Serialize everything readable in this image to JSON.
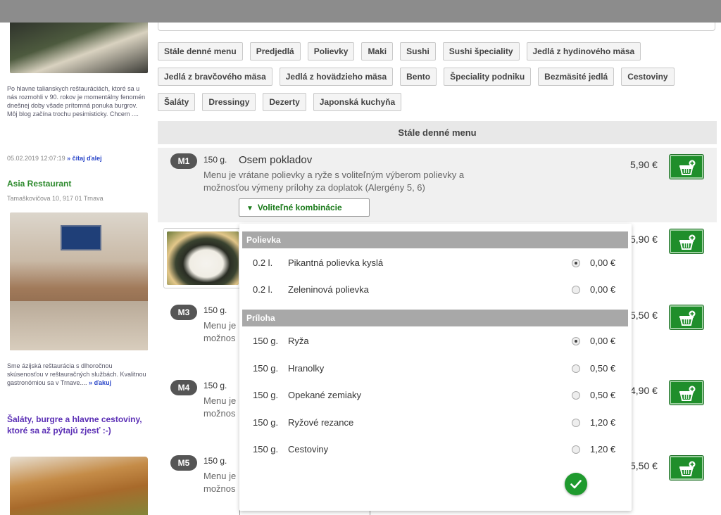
{
  "left": {
    "blog_text": "Po hlavne talianskych reštauráciách, ktoré sa u nás rozmohli v 90. rokov je momentálny fenomén dnešnej doby všade prítomná ponuka burgrov. Môj blog začína trochu pesimisticky. Chcem ....",
    "blog_meta": "05.02.2019 12:07:19",
    "read_more": "» čítaj ďalej",
    "restaurant_name": "Asia Restaurant",
    "restaurant_address": "Tamaškovičova 10, 917 01 Trnava",
    "rest_text": "Sme ázijská reštaurácia s dlhoročnou skúsenosťou v reštauračných službách. Kvalitnou gastronómiou sa v Trnave....",
    "rest_more": "» ďakuj",
    "headline": "Šaláty, burgre a hlavne cestoviny, ktoré sa až pýtajú zjesť :-)"
  },
  "categories": [
    "Stále denné menu",
    "Predjedlá",
    "Polievky",
    "Maki",
    "Sushi",
    "Sushi špeciality",
    "Jedlá z hydinového mäsa",
    "Jedlá z bravčového mäsa",
    "Jedlá z hovädzieho mäsa",
    "Bento",
    "Špeciality podniku",
    "Bezmäsité jedlá",
    "Cestoviny",
    "Šaláty",
    "Dressingy",
    "Dezerty",
    "Japonská kuchyňa"
  ],
  "section_title": "Stále denné menu",
  "items": {
    "m1": {
      "code": "M1",
      "weight": "150 g.",
      "name": "Osem pokladov",
      "desc": "Menu je vrátane polievky a ryže s voliteľným výberom polievky a možnosťou výmeny prílohy za doplatok (Alergény 5, 6)",
      "price": "5,90 €",
      "combo": "Voliteľné kombinácie"
    },
    "m2": {
      "price": "5,90 €"
    },
    "m3": {
      "code": "M3",
      "weight": "150 g.",
      "desc": "Menu je",
      "desc2": "možnos",
      "price": "5,50 €"
    },
    "m4": {
      "code": "M4",
      "weight": "150 g.",
      "desc": "Menu je",
      "desc2": "možnos",
      "price": "4,90 €"
    },
    "m5": {
      "code": "M5",
      "weight": "150 g.",
      "desc": "Menu je",
      "desc2": "možnos",
      "price": "5,50 €"
    }
  },
  "combo_panel": {
    "groups": [
      {
        "title": "Polievka",
        "options": [
          {
            "weight": "0.2 l.",
            "name": "Pikantná polievka kyslá",
            "price": "0,00 €",
            "selected": true
          },
          {
            "weight": "0.2 l.",
            "name": "Zeleninová polievka",
            "price": "0,00 €",
            "selected": false
          }
        ]
      },
      {
        "title": "Príloha",
        "options": [
          {
            "weight": "150 g.",
            "name": "Ryža",
            "price": "0,00 €",
            "selected": true
          },
          {
            "weight": "150 g.",
            "name": "Hranolky",
            "price": "0,50 €",
            "selected": false
          },
          {
            "weight": "150 g.",
            "name": "Opekané zemiaky",
            "price": "0,50 €",
            "selected": false
          },
          {
            "weight": "150 g.",
            "name": "Ryžové rezance",
            "price": "1,20 €",
            "selected": false
          },
          {
            "weight": "150 g.",
            "name": "Cestoviny",
            "price": "1,20 €",
            "selected": false
          }
        ]
      }
    ]
  },
  "colors": {
    "accent_green": "#1f8e2b",
    "badge": "#555555",
    "link_blue": "#2a46c9",
    "headline_purple": "#5b2fb5"
  },
  "icons": {
    "cart": "basket-plus-icon",
    "confirm": "check-icon",
    "combo": "triangle-down-icon"
  }
}
